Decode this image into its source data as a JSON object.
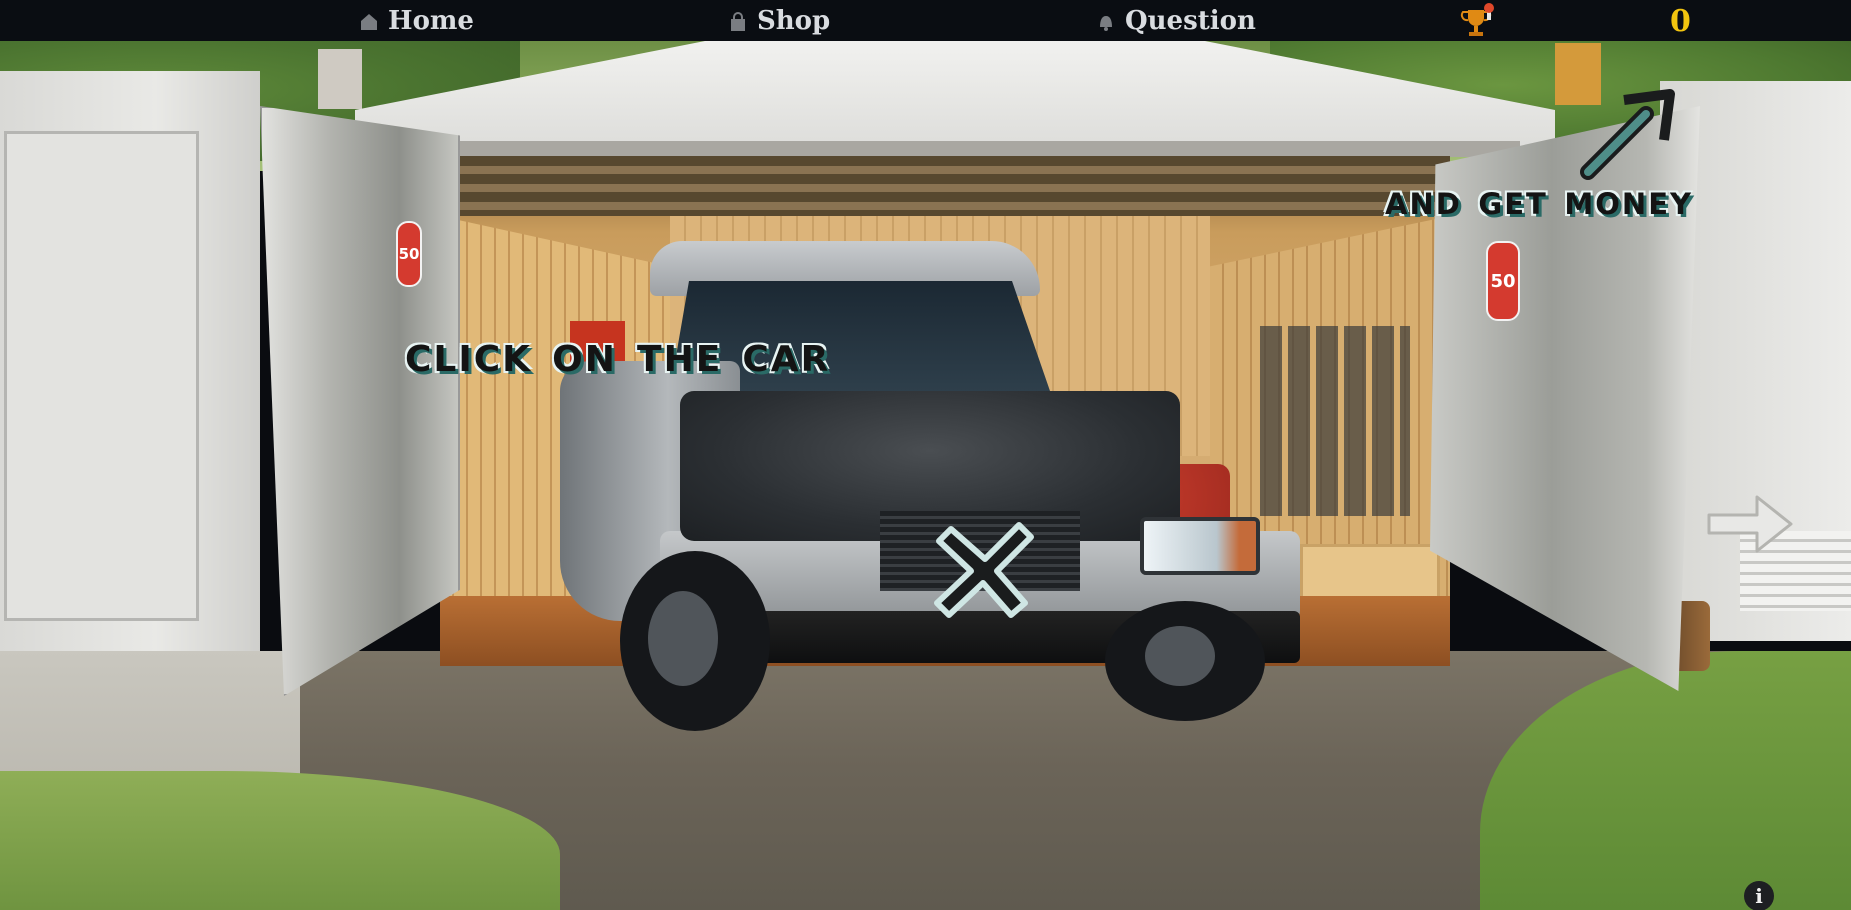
{
  "nav": {
    "home": {
      "label": "Home",
      "icon": "home-icon"
    },
    "shop": {
      "label": "Shop",
      "icon": "shopping-bag-icon"
    },
    "question": {
      "label": "Question",
      "icon": "bell-icon"
    },
    "trophy": {
      "icon": "trophy-icon"
    },
    "coins": "0"
  },
  "scene": {
    "instruction": "click on the car",
    "reward_hint": "and get money",
    "door_badge_left": "50",
    "door_badge_right": "50",
    "cross_icon": "close-icon",
    "hint_arrow_icon": "diagonal-arrow-icon",
    "next_arrow_icon": "arrow-right-icon",
    "info_label": "i"
  },
  "colors": {
    "topbar_bg": "#0a0d12",
    "coin_color": "#f2c40f",
    "text_outline": "#2a6a66"
  }
}
